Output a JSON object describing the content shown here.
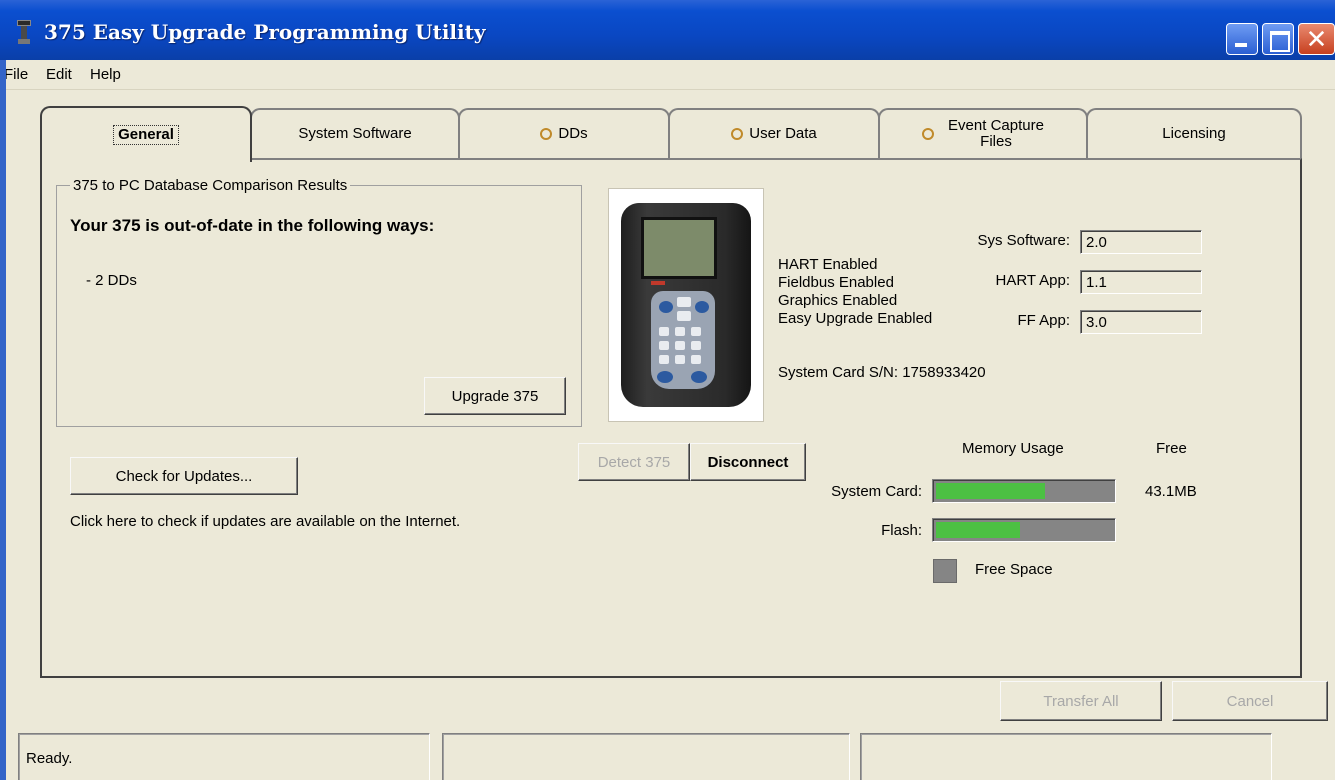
{
  "window": {
    "title": "375 Easy Upgrade Programming Utility"
  },
  "menu": {
    "file": "File",
    "edit": "Edit",
    "help": "Help"
  },
  "tabs": {
    "general": "General",
    "system_software": "System Software",
    "dds": "DDs",
    "user_data": "User Data",
    "event_capture_line1": "Event Capture",
    "event_capture_line2": "Files",
    "licensing": "Licensing"
  },
  "comparison": {
    "group_title": "375 to PC Database Comparison Results",
    "headline": "Your 375 is out-of-date in the following ways:",
    "items": [
      "- 2 DDs"
    ],
    "upgrade_button": "Upgrade 375"
  },
  "updates": {
    "check_button": "Check for Updates...",
    "hint": "Click here to check if updates are available on the Internet."
  },
  "connection": {
    "detect_button": "Detect 375",
    "disconnect_button": "Disconnect"
  },
  "device": {
    "features": [
      "HART Enabled",
      "Fieldbus Enabled",
      "Graphics Enabled",
      "Easy Upgrade Enabled"
    ],
    "sys_software_label": "Sys Software:",
    "sys_software_value": "2.0",
    "hart_app_label": "HART App:",
    "hart_app_value": "1.1",
    "ff_app_label": "FF App:",
    "ff_app_value": "3.0",
    "serial_text": "System Card  S/N: 1758933420"
  },
  "memory": {
    "usage_header": "Memory Usage",
    "free_header": "Free",
    "system_card_label": "System Card:",
    "system_card_used_fraction": 0.62,
    "system_card_free": "43.1MB",
    "flash_label": "Flash:",
    "flash_used_fraction": 0.48,
    "legend_label": "Free Space",
    "used_color": "#4cc043",
    "free_color": "#858585"
  },
  "actions": {
    "transfer_all": "Transfer All",
    "cancel": "Cancel"
  },
  "status": {
    "text": "Ready."
  }
}
